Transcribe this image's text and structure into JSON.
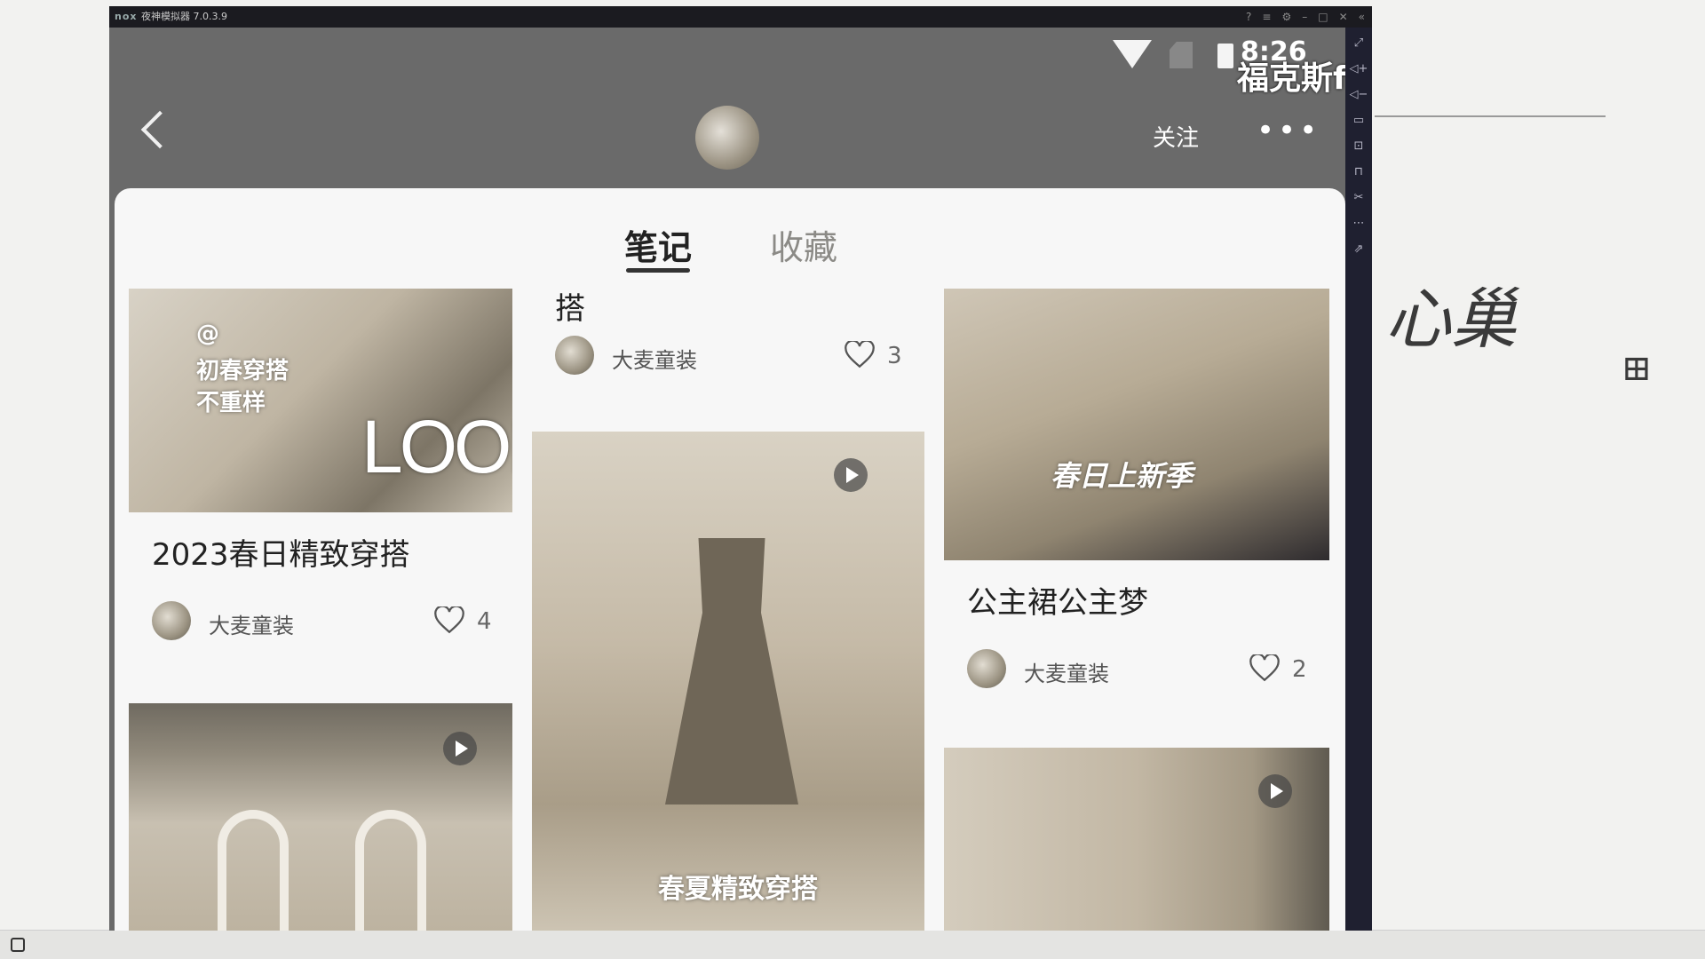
{
  "emulator": {
    "logo": "nox",
    "title": "夜神模拟器 7.0.3.9"
  },
  "status_bar": {
    "time": "8:26",
    "overlay_text": "福克斯fa"
  },
  "header": {
    "follow_label": "关注",
    "more_label": "•••"
  },
  "tabs": [
    {
      "label": "笔记",
      "active": true
    },
    {
      "label": "收藏",
      "active": false
    }
  ],
  "cards": [
    {
      "title": "2023春日精致穿搭",
      "image_text": [
        "@",
        "初春穿搭",
        "不重样",
        "LOOK"
      ],
      "author": "大麦童装",
      "likes": "4"
    },
    {
      "title": "搭",
      "author": "大麦童装",
      "likes": "3"
    },
    {
      "title": "公主裙公主梦",
      "image_text": [
        "春日上新季"
      ],
      "author": "大麦童装",
      "likes": "2"
    },
    {
      "image_text": [
        "春夏精致穿搭"
      ],
      "has_video": true
    },
    {
      "has_video": true
    },
    {
      "has_video": true
    }
  ],
  "background": {
    "handwriting": "心巢"
  }
}
